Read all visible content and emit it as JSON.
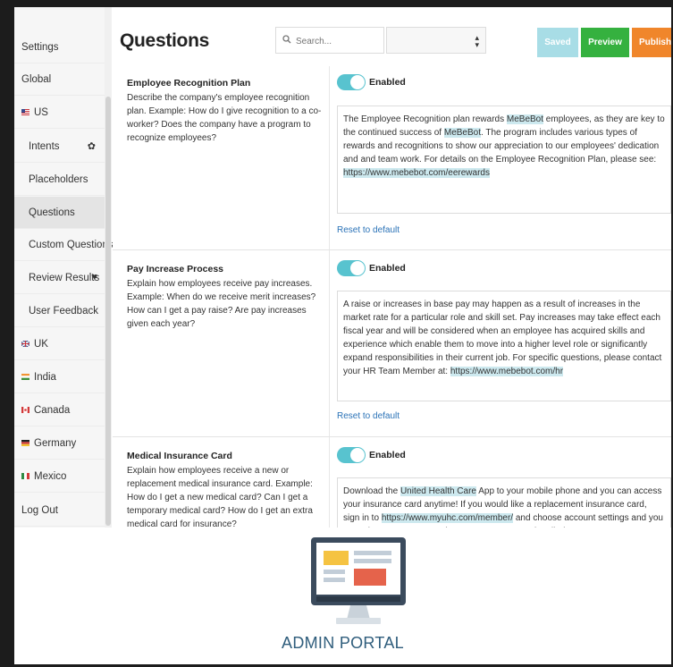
{
  "sidebar": {
    "items": [
      {
        "label": "Settings",
        "level": "top"
      },
      {
        "label": "Global",
        "level": "top"
      },
      {
        "label": "US",
        "level": "top",
        "flag": "us"
      },
      {
        "label": "Intents",
        "level": "sub",
        "icon": "gear-icon"
      },
      {
        "label": "Placeholders",
        "level": "sub"
      },
      {
        "label": "Questions",
        "level": "sub",
        "active": true
      },
      {
        "label": "Custom Questions",
        "level": "sub"
      },
      {
        "label": "Review Results",
        "level": "sub",
        "icon": "heart-icon"
      },
      {
        "label": "User Feedback",
        "level": "sub"
      },
      {
        "label": "UK",
        "level": "top",
        "flag": "uk"
      },
      {
        "label": "India",
        "level": "top",
        "flag": "india"
      },
      {
        "label": "Canada",
        "level": "top",
        "flag": "canada"
      },
      {
        "label": "Germany",
        "level": "top",
        "flag": "germany"
      },
      {
        "label": "Mexico",
        "level": "top",
        "flag": "mexico"
      },
      {
        "label": "Log Out",
        "level": "top"
      }
    ]
  },
  "header": {
    "title": "Questions",
    "search_placeholder": "Search...",
    "select_value": "",
    "saved_label": "Saved",
    "preview_label": "Preview",
    "publish_label": "Publish"
  },
  "questions": [
    {
      "title": "Employee Recognition Plan",
      "description": "Describe the company's employee recognition plan. Example: How do I give recognition to a co-worker? Does the company have a program to recognize employees?",
      "toggle_label": "Enabled",
      "enabled": true,
      "answer_parts": [
        {
          "t": "The Employee Recognition plan rewards "
        },
        {
          "t": "MeBeBot",
          "hl": true
        },
        {
          "t": " employees, as they are key to the continued success of "
        },
        {
          "t": "MeBeBot",
          "hl": true
        },
        {
          "t": ". The program includes various types of rewards and recognitions to show our appreciation to our employees' dedication and and team work. For details on the Employee Recognition Plan, please see: "
        },
        {
          "t": "https://www.mebebot.com/eerewards",
          "hl": true
        }
      ],
      "reset_label": "Reset to default"
    },
    {
      "title": "Pay Increase Process",
      "description": "Explain how employees receive pay increases. Example: When do we receive merit increases? How can I get a pay raise? Are pay increases given each year?",
      "toggle_label": "Enabled",
      "enabled": true,
      "answer_parts": [
        {
          "t": "A raise or increases in base pay may happen as a result of increases in the market rate for a particular role and skill set. Pay increases may take effect each fiscal year and will be considered when an employee has acquired skills and experience which enable them to move into a higher level role or significantly expand responsibilities in their current job. For specific questions, please contact your HR Team Member at: "
        },
        {
          "t": "https://www.mebebot.com/hr",
          "hl": true
        }
      ],
      "reset_label": "Reset to default"
    },
    {
      "title": "Medical Insurance Card",
      "description": "Explain how employees receive a new or replacement medical insurance card. Example: How do I get a new medical card? Can I get a temporary medical card? How do I get an extra medical card for insurance?",
      "toggle_label": "Enabled",
      "enabled": true,
      "answer_parts": [
        {
          "t": "Download the "
        },
        {
          "t": "United Health Care",
          "hl": true
        },
        {
          "t": " App to your mobile phone and you can access your insurance card anytime! If you would like a replacement insurance card, sign in to "
        },
        {
          "t": "https://www.myuhc.com/member/",
          "hl": true
        },
        {
          "t": " and choose account settings and you can print a temporary card or request a new card mailed to your"
        }
      ],
      "reset_label": ""
    }
  ],
  "footer": {
    "portal_label": "ADMIN PORTAL",
    "icon": "monitor-icon"
  },
  "colors": {
    "toggle": "#58c3cf",
    "saved": "#a8dde6",
    "preview": "#35b13f",
    "publish": "#f0862b",
    "link": "#2a72b7",
    "highlight": "#cde9ef",
    "portal_text": "#2f5d7c"
  }
}
